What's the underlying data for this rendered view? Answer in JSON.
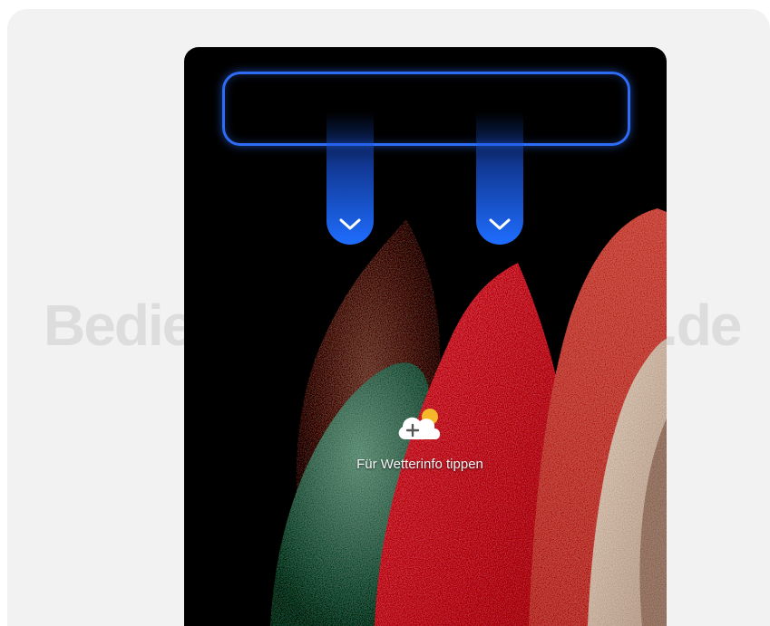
{
  "watermark": {
    "left_part": "Bedie",
    "right_part": ".de"
  },
  "lock_screen": {
    "weather_label": "Für Wetterinfo tippen",
    "weather_icon": "cloud-plus-icon",
    "swipe_icon": "chevron-down-icon"
  },
  "colors": {
    "accent": "#2f6cf5",
    "swipe_bottom": "#1f6dff",
    "background": "#f2f2f2"
  }
}
